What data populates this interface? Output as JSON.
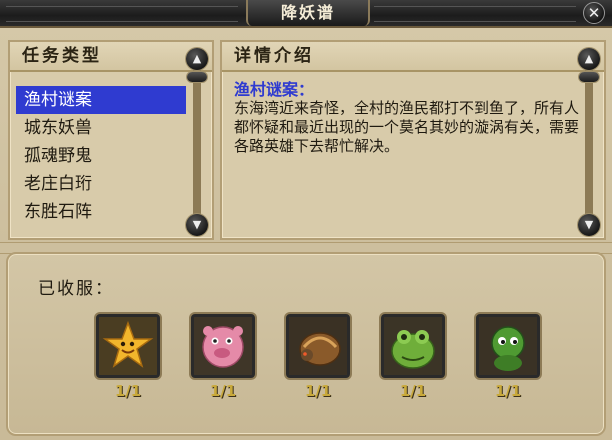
{
  "window": {
    "title": "降妖谱",
    "close_icon": "close-icon"
  },
  "task_panel": {
    "header": "任务类型",
    "items": [
      {
        "label": "渔村谜案",
        "selected": true
      },
      {
        "label": "城东妖兽",
        "selected": false
      },
      {
        "label": "孤魂野鬼",
        "selected": false
      },
      {
        "label": "老庄白珩",
        "selected": false
      },
      {
        "label": "东胜石阵",
        "selected": false
      }
    ]
  },
  "detail_panel": {
    "header": "详情介绍",
    "title": "渔村谜案：",
    "body": "东海湾近来奇怪，全村的渔民都打不到鱼了，所有人都怀疑和最近出现的一个莫名其妙的漩涡有关，需要各路英雄下去帮忙解决。"
  },
  "collected": {
    "label": "已收服：",
    "monsters": [
      {
        "icon": "yellow-star-monster-icon",
        "count": "1/1"
      },
      {
        "icon": "pink-pig-monster-icon",
        "count": "1/1"
      },
      {
        "icon": "brown-shell-monster-icon",
        "count": "1/1"
      },
      {
        "icon": "green-frog-monster-icon",
        "count": "1/1"
      },
      {
        "icon": "green-ghost-monster-icon",
        "count": "1/1"
      }
    ]
  },
  "colors": {
    "selection": "#2f3bd0",
    "count_text": "#c8a93c",
    "panel_bg": "#d8cbaa"
  }
}
